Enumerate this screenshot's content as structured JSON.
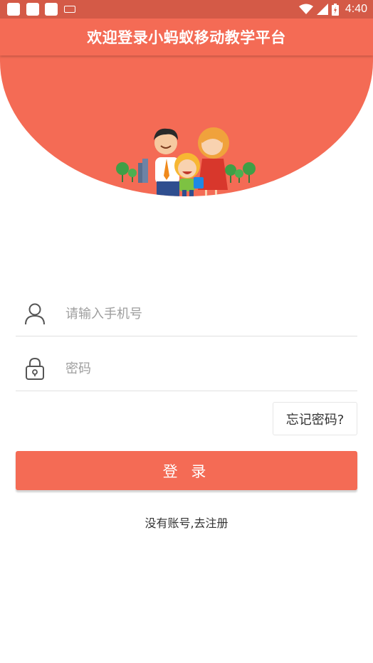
{
  "status_bar": {
    "time": "4:40"
  },
  "header": {
    "title": "欢迎登录小蚂蚁移动教学平台"
  },
  "colors": {
    "primary": "#f46b55",
    "status_bar": "#d45a47"
  },
  "login_form": {
    "phone_placeholder": "请输入手机号",
    "phone_icon": "user-icon",
    "password_placeholder": "密码",
    "password_icon": "lock-icon",
    "forgot_label": "忘记密码?",
    "login_label": "登 录",
    "register_label": "没有账号,去注册"
  }
}
